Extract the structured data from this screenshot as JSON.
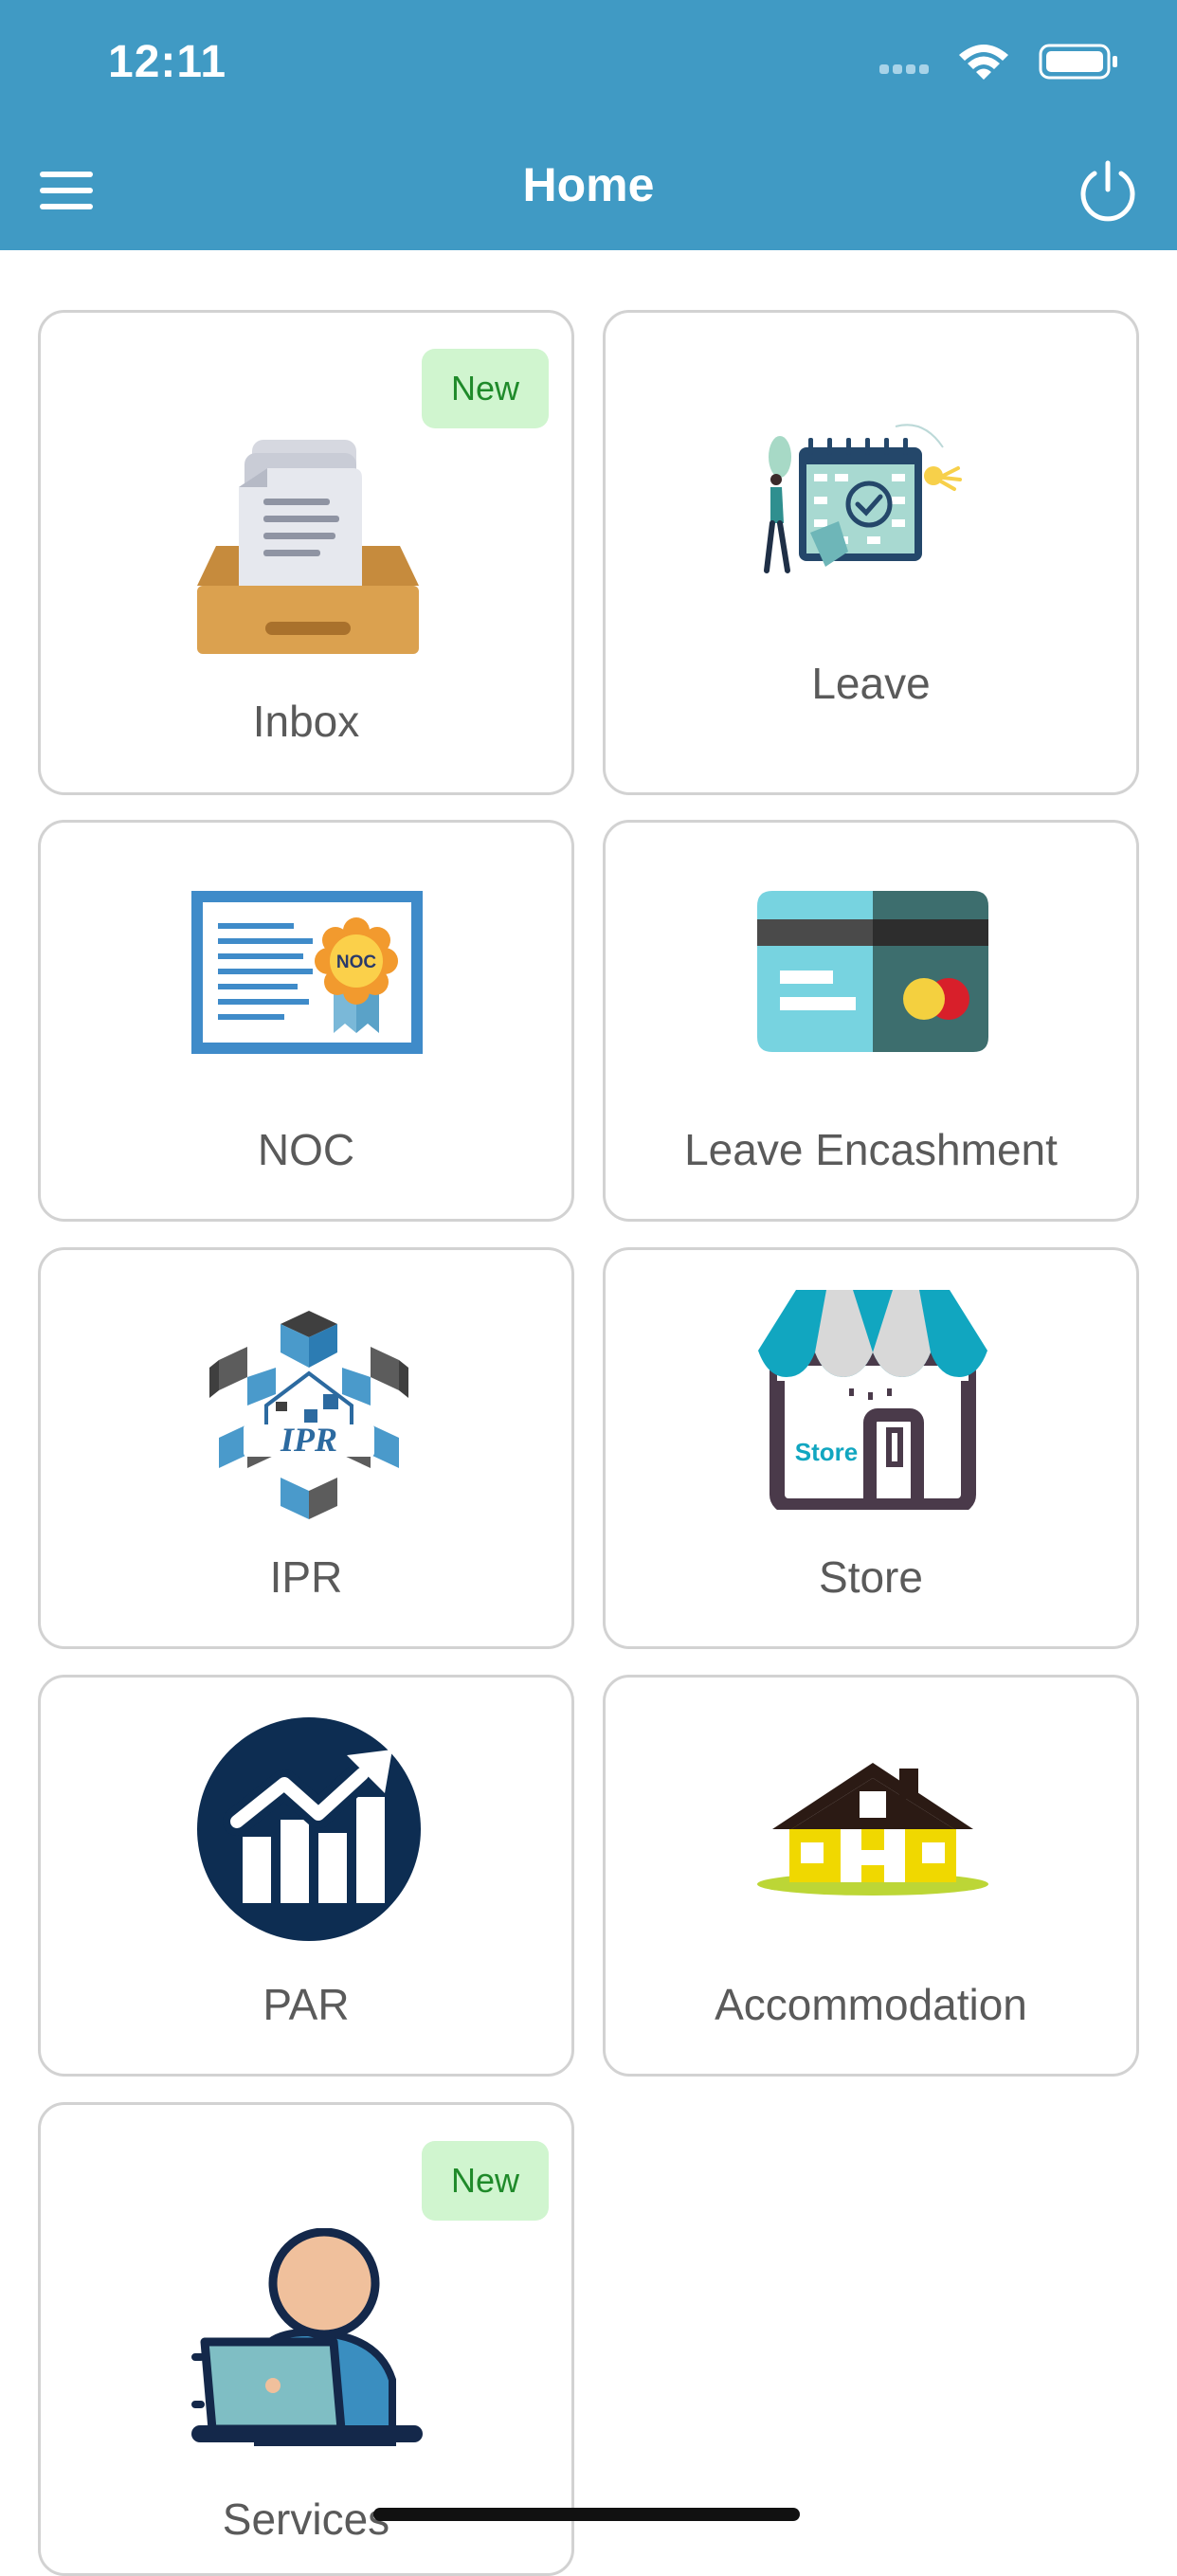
{
  "status_bar": {
    "time": "12:11",
    "icons": [
      "signal-icon",
      "wifi-icon",
      "battery-icon"
    ]
  },
  "nav": {
    "title": "Home",
    "menu_icon": "hamburger-menu-icon",
    "power_icon": "power-icon"
  },
  "colors": {
    "header": "#409ac4",
    "card_border": "#d2d2d2",
    "badge_bg": "#d0f5cf",
    "badge_text": "#1f8a2a",
    "label": "#5a5a5a"
  },
  "tiles": [
    {
      "label": "Inbox",
      "badge": "New",
      "icon": "inbox-tray-icon"
    },
    {
      "label": "Leave",
      "icon": "calendar-leave-icon"
    },
    {
      "label": "NOC",
      "icon": "noc-certificate-icon"
    },
    {
      "label": "Leave Encashment",
      "icon": "credit-card-icon"
    },
    {
      "label": "IPR",
      "icon": "ipr-logo-icon"
    },
    {
      "label": "Store",
      "icon": "store-front-icon"
    },
    {
      "label": "PAR",
      "icon": "growth-chart-icon"
    },
    {
      "label": "Accommodation",
      "icon": "house-icon"
    },
    {
      "label": "Services",
      "badge": "New",
      "icon": "person-laptop-icon"
    }
  ]
}
